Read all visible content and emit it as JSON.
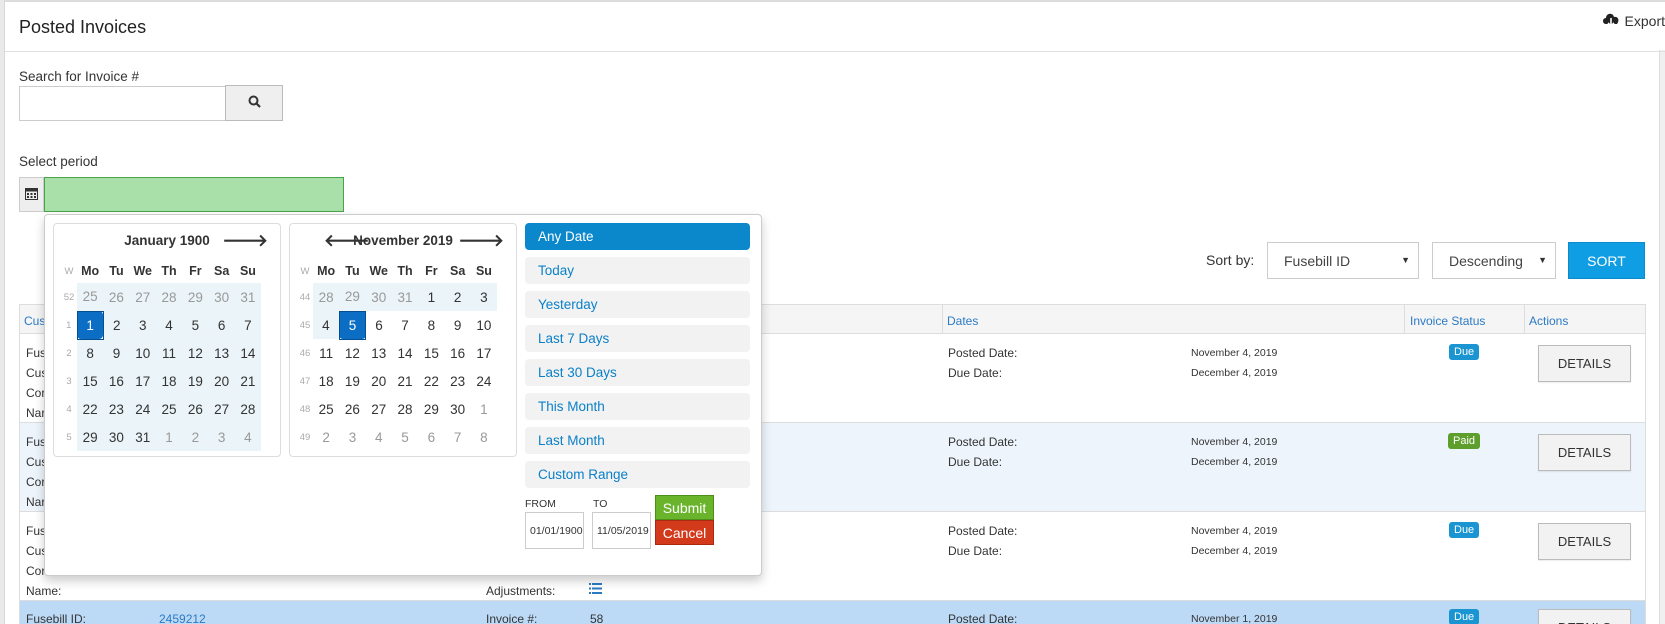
{
  "page": {
    "title": "Posted Invoices",
    "export_label": "Export"
  },
  "search": {
    "label": "Search for Invoice #",
    "value": ""
  },
  "period": {
    "label": "Select period",
    "value": ""
  },
  "sort": {
    "label": "Sort by:",
    "field": "Fusebill ID",
    "order": "Descending",
    "button_label": "SORT"
  },
  "table": {
    "headers": {
      "customer": "Cus",
      "dates": "Dates",
      "status": "Invoice Status",
      "actions": "Actions"
    },
    "rows": [
      {
        "left_labels": [
          "Fus",
          "Cus",
          "Cor",
          "Nar"
        ],
        "posted_label": "Posted Date:",
        "posted_value": "November 4, 2019",
        "due_label": "Due Date:",
        "due_value": "December 4, 2019",
        "status": "Due",
        "details": "DETAILS"
      },
      {
        "left_labels": [
          "Fus",
          "Cus",
          "Cor",
          "Nar"
        ],
        "posted_label": "Posted Date:",
        "posted_value": "November 4, 2019",
        "due_label": "Due Date:",
        "due_value": "December 4, 2019",
        "status": "Paid",
        "details": "DETAILS"
      },
      {
        "left_labels": [
          "Fus",
          "Cus",
          "Cor",
          "Name:"
        ],
        "adjust_label": "Adjustments:",
        "posted_label": "Posted Date:",
        "posted_value": "November 4, 2019",
        "due_label": "Due Date:",
        "due_value": "December 4, 2019",
        "status": "Due",
        "details": "DETAILS"
      },
      {
        "fusebill_label": "Fusebill ID:",
        "fusebill_value": "2459212",
        "invoice_label": "Invoice #:",
        "invoice_value": "58",
        "posted_label": "Posted Date:",
        "posted_value": "November 1, 2019",
        "status": "Due",
        "details": "DETAILS"
      }
    ]
  },
  "picker": {
    "weekday_header": [
      "W",
      "Mo",
      "Tu",
      "We",
      "Th",
      "Fr",
      "Sa",
      "Su"
    ],
    "left_calendar": {
      "month": "January 1900",
      "weeks": [
        [
          "52",
          "25",
          "26",
          "27",
          "28",
          "29",
          "30",
          "31"
        ],
        [
          "1",
          "1",
          "2",
          "3",
          "4",
          "5",
          "6",
          "7"
        ],
        [
          "2",
          "8",
          "9",
          "10",
          "11",
          "12",
          "13",
          "14"
        ],
        [
          "3",
          "15",
          "16",
          "17",
          "18",
          "19",
          "20",
          "21"
        ],
        [
          "4",
          "22",
          "23",
          "24",
          "25",
          "26",
          "27",
          "28"
        ],
        [
          "5",
          "29",
          "30",
          "31",
          "1",
          "2",
          "3",
          "4"
        ]
      ]
    },
    "right_calendar": {
      "month": "November 2019",
      "weeks": [
        [
          "44",
          "28",
          "29",
          "30",
          "31",
          "1",
          "2",
          "3"
        ],
        [
          "45",
          "4",
          "5",
          "6",
          "7",
          "8",
          "9",
          "10"
        ],
        [
          "46",
          "11",
          "12",
          "13",
          "14",
          "15",
          "16",
          "17"
        ],
        [
          "47",
          "18",
          "19",
          "20",
          "21",
          "22",
          "23",
          "24"
        ],
        [
          "48",
          "25",
          "26",
          "27",
          "28",
          "29",
          "30",
          "1"
        ],
        [
          "49",
          "2",
          "3",
          "4",
          "5",
          "6",
          "7",
          "8"
        ]
      ]
    },
    "ranges": [
      "Any Date",
      "Today",
      "Yesterday",
      "Last 7 Days",
      "Last 30 Days",
      "This Month",
      "Last Month",
      "Custom Range"
    ],
    "active_range": "Any Date",
    "from_label": "FROM",
    "to_label": "TO",
    "from_value": "01/01/1900",
    "to_value": "11/05/2019",
    "submit_label": "Submit",
    "cancel_label": "Cancel"
  }
}
